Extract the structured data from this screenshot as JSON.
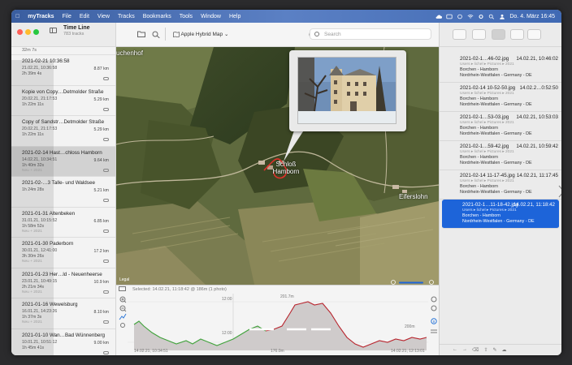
{
  "menubar": {
    "app": "myTracks",
    "items": [
      "File",
      "Edit",
      "View",
      "Tracks",
      "Bookmarks",
      "Tools",
      "Window",
      "Help"
    ],
    "datetime": "Do. 4. März  16:45"
  },
  "sidebar": {
    "title": "Time Line",
    "subtitle": "783 tracks",
    "top_duration": "32m 7s",
    "tracks": [
      {
        "name": "2021-02-21 10:36:58",
        "date": "21.02.21, 10:36:58",
        "duration": "2h 39m 4s",
        "distance": "8.87 km",
        "extra": ""
      },
      {
        "name": "Kopie von Copy…Detmolder Straße",
        "date": "20.02.21, 21:17:53",
        "duration": "1h 22m 11s",
        "distance": "5.29 km",
        "extra": ""
      },
      {
        "name": "Copy of Sandstr…Detmolder Straße",
        "date": "20.02.21, 21:17:53",
        "duration": "1h 22m 11s",
        "distance": "5.29 km",
        "extra": ""
      },
      {
        "name": "2021-02-14 Hast…chloss Hamborn",
        "date": "14.02.21, 10:34:51",
        "duration": "1h 40m 32s",
        "distance": "9.64 km",
        "extra": "Neu + 2021"
      },
      {
        "name": "2021-02-…3 Talle- und Waldsee",
        "date": "",
        "duration": "1h 24m 28s",
        "distance": "5.21 km",
        "extra": ""
      },
      {
        "name": "2021-01-31 Altenbeken",
        "date": "31.01.21, 10:15:52",
        "duration": "1h 58m 52s",
        "distance": "6.85 km",
        "extra": "Neu + 2021"
      },
      {
        "name": "2021-01-30 Paderborn",
        "date": "30.01.21, 12:41:00",
        "duration": "3h 30m 26s",
        "distance": "17.2 km",
        "extra": "Neu + 2021"
      },
      {
        "name": "2021-01-23 Her…ld - Neuenheerse",
        "date": "23.01.21, 10:49:15",
        "duration": "2h 21m 34s",
        "distance": "10.9 km",
        "extra": "Neu + 2021"
      },
      {
        "name": "2021-01-16 Wewelsburg",
        "date": "16.01.21, 14:23:26",
        "duration": "1h 37m 3s",
        "distance": "8.10 km",
        "extra": "Neu + 2021"
      },
      {
        "name": "2021-01-10 Wan…Bad Wünnenberg",
        "date": "10.01.21, 10:51:12",
        "duration": "1h 45m 41s",
        "distance": "9.00 km",
        "extra": ""
      }
    ]
  },
  "toolbar": {
    "map_type": "Apple Hybrid Map",
    "search_placeholder": "Search"
  },
  "map": {
    "labels": [
      "Schloß Hamborn",
      "Eiferslohn",
      "uchenhof"
    ],
    "legal": "Legal"
  },
  "elevation": {
    "selected": "Selected: 14.02.21, 11:18:42 @ 186m (1 photo)",
    "altitude_label": "201.7m",
    "time_top": "12:00",
    "time_mid": "12:00",
    "min_label": "200m",
    "x_start": "14.02.21, 10:34:51",
    "x_mid": "176.0m",
    "x_end": "14.02.21, 12:13:01"
  },
  "photos": [
    {
      "name": "2021-02-1…46-02.jpg",
      "time": "14.02.21, 10:46:02",
      "path": "Users ▸ lichel ▸ Pictures ▸ 2021",
      "place": "Borchen - Hamborn",
      "region": "Nordrhein-Westfalen - Germany - DE"
    },
    {
      "name": "2021-02-14 10-52-50.jpg",
      "time": "14.02.2…0:52:50",
      "path": "Users ▸ lichel ▸ Pictures ▸ 2021",
      "place": "Borchen - Hamborn",
      "region": "Nordrhein-Westfalen - Germany - DE"
    },
    {
      "name": "2021-02-1…53-03.jpg",
      "time": "14.02.21, 10:53:03",
      "path": "Users ▸ lichel ▸ Pictures ▸ 2021",
      "place": "Borchen - Hamborn",
      "region": "Nordrhein-Westfalen - Germany - DE"
    },
    {
      "name": "2021-02-1…59-42.jpg",
      "time": "14.02.21, 10:59:42",
      "path": "Users ▸ lichel ▸ Pictures ▸ 2021",
      "place": "Borchen - Hamborn",
      "region": "Nordrhein-Westfalen - Germany - DE"
    },
    {
      "name": "2021-02-14 11-17-45.jpg",
      "time": "14.02.21, 11:17:45",
      "path": "Users ▸ lichel ▸ Pictures ▸ 2021",
      "place": "Borchen - Hamborn",
      "region": "Nordrhein-Westfalen - Germany - DE"
    },
    {
      "name": "2021-02-1…11-18-42.jpg",
      "time": "14.02.21, 11:18:42",
      "path": "Users ▸ lichel ▸ Pictures ▸ 2021",
      "place": "Borchen - Hamborn",
      "region": "Nordrhein-Westfalen - Germany - DE"
    }
  ],
  "colors": {
    "selection": "#1d64d9",
    "track": "#e0312b",
    "elev_up": "#3fa23a",
    "elev_down": "#b8242d"
  }
}
